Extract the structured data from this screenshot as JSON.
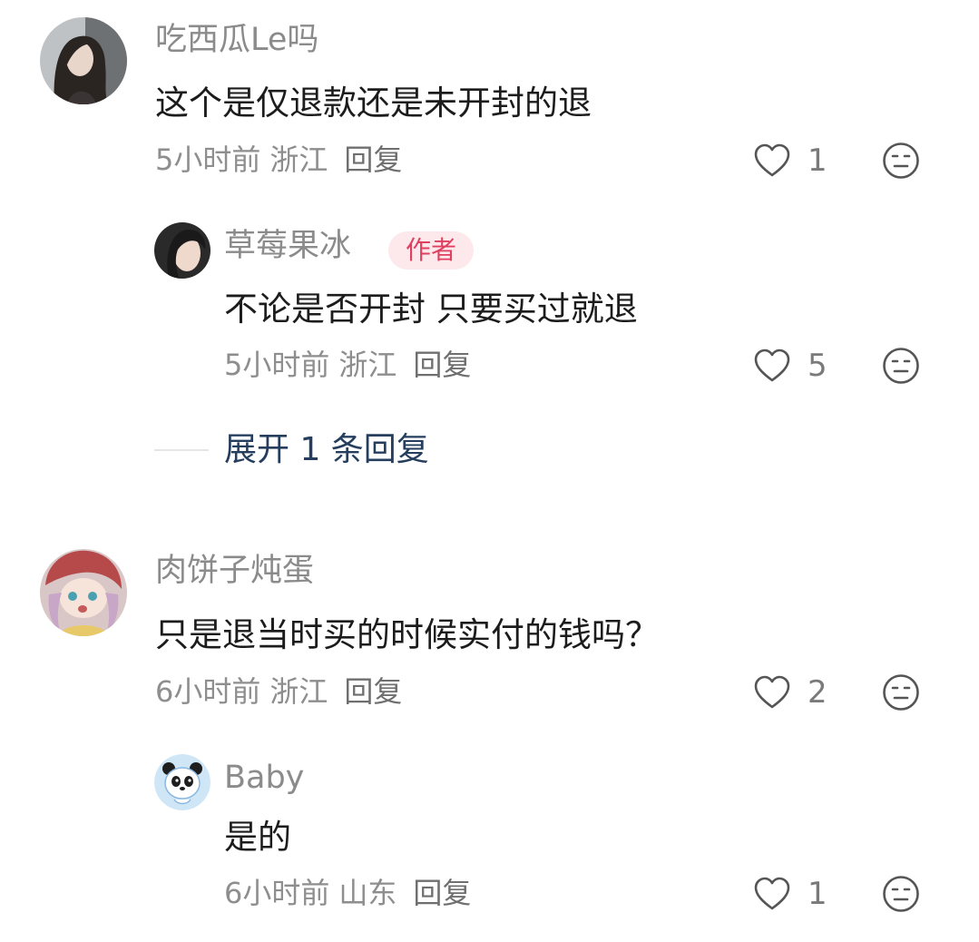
{
  "comments": [
    {
      "username": "吃西瓜Le吗",
      "text": "这个是仅退款还是未开封的退",
      "time": "5小时前",
      "location": "浙江",
      "reply_label": "回复",
      "likes": "1",
      "replies": [
        {
          "username": "草莓果冰",
          "badge": "作者",
          "text": "不论是否开封 只要买过就退",
          "time": "5小时前",
          "location": "浙江",
          "reply_label": "回复",
          "likes": "5"
        }
      ],
      "expand_label": "展开 1 条回复"
    },
    {
      "username": "肉饼子炖蛋",
      "text": "只是退当时买的时候实付的钱吗？",
      "time": "6小时前",
      "location": "浙江",
      "reply_label": "回复",
      "likes": "2",
      "replies": [
        {
          "username": "Baby",
          "text": "是的",
          "time": "6小时前",
          "location": "山东",
          "reply_label": "回复",
          "likes": "1"
        }
      ]
    }
  ],
  "icons": {
    "like": "heart-outline-icon",
    "emoji": "neutral-face-icon"
  },
  "colors": {
    "author_badge_bg": "#fde8ec",
    "author_badge_text": "#e04060",
    "expand_text": "#253e5e"
  }
}
